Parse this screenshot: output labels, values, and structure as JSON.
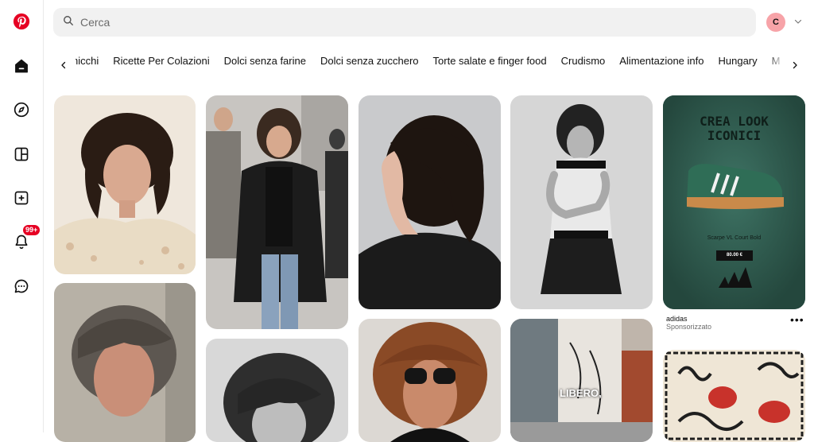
{
  "search": {
    "placeholder": "Cerca"
  },
  "account": {
    "initial": "C"
  },
  "notifications": {
    "badge": "99+"
  },
  "chips": [
    "hicchi",
    "Ricette Per Colazioni",
    "Dolci senza farine",
    "Dolci senza zucchero",
    "Torte salate e finger food",
    "Crudismo",
    "Alimentazione info",
    "Hungary",
    "M"
  ],
  "ad": {
    "headline_1": "CREA LOOK",
    "headline_2": "ICONICI",
    "product": "Scarpe VL Court Bold",
    "price": "80.00 €",
    "advertiser": "adidas",
    "sponsored": "Sponsorizzato"
  },
  "pins": {
    "libero_text": "LIBERO,"
  },
  "colors": {
    "brand": "#e60023",
    "ad_green": "#2f5a4e",
    "avatar": "#f7a3a8"
  }
}
